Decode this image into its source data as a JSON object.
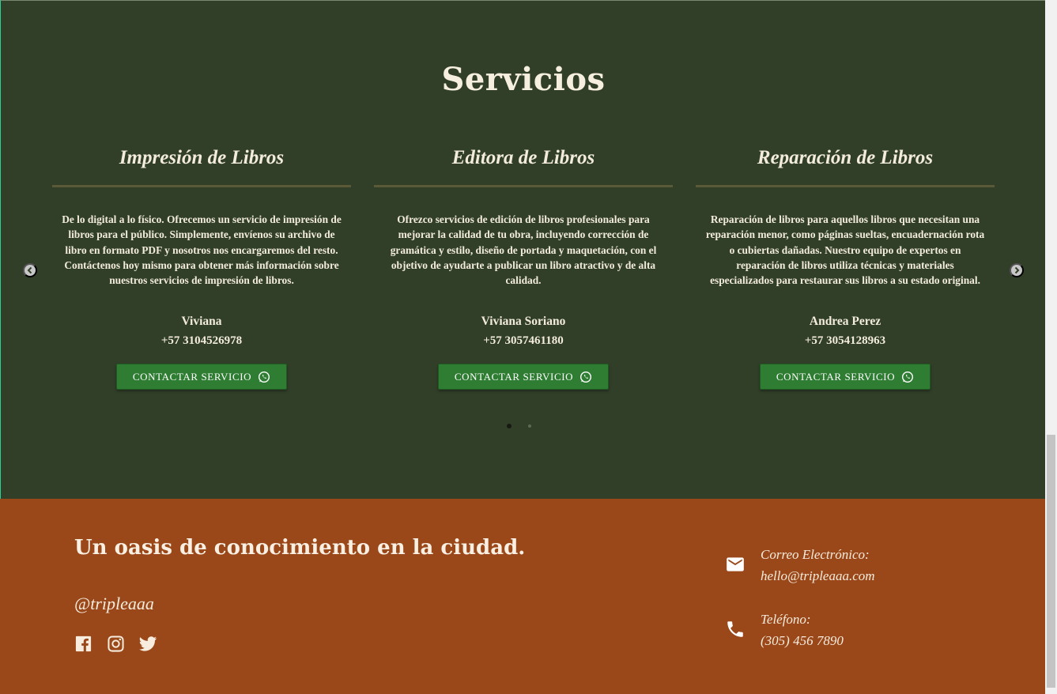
{
  "services": {
    "title": "Servicios",
    "cards": [
      {
        "title": "Impresión de Libros",
        "description": "De lo digital a lo físico. Ofrecemos un servicio de impresión de libros para el público. Simplemente, envíenos su archivo de libro en formato PDF y nosotros nos encargaremos del resto. Contáctenos hoy mismo para obtener más información sobre nuestros servicios de impresión de libros.",
        "name": "Viviana",
        "phone": "+57 3104526978",
        "button": "CONTACTAR SERVICIO"
      },
      {
        "title": "Editora de Libros",
        "description": "Ofrezco servicios de edición de libros profesionales para mejorar la calidad de tu obra, incluyendo corrección de gramática y estilo, diseño de portada y maquetación, con el objetivo de ayudarte a publicar un libro atractivo y de alta calidad.",
        "name": "Viviana Soriano",
        "phone": "+57 3057461180",
        "button": "CONTACTAR SERVICIO"
      },
      {
        "title": "Reparación de Libros",
        "description": "Reparación de libros para aquellos libros que necesitan una reparación menor, como páginas sueltas, encuadernación rota o cubiertas dañadas. Nuestro equipo de expertos en reparación de libros utiliza técnicas y materiales especializados para restaurar sus libros a su estado original.",
        "name": "Andrea Perez",
        "phone": "+57 3054128963",
        "button": "CONTACTAR SERVICIO"
      }
    ],
    "carousel": {
      "pages": 2,
      "active_page": 1
    }
  },
  "footer": {
    "tagline": "Un oasis de conocimiento en la ciudad.",
    "handle": "@tripleaaa",
    "social_icons": [
      "facebook-icon",
      "instagram-icon",
      "twitter-icon"
    ],
    "email": {
      "label": "Correo Electrónico:",
      "value": "hello@tripleaaa.com"
    },
    "phone": {
      "label": "Teléfono:",
      "value": "(305) 456 7890"
    }
  },
  "colors": {
    "services_bg": "#313f29",
    "footer_bg": "#9a4819",
    "button_bg": "#2e7d32",
    "text_light": "#f3ecdc"
  }
}
